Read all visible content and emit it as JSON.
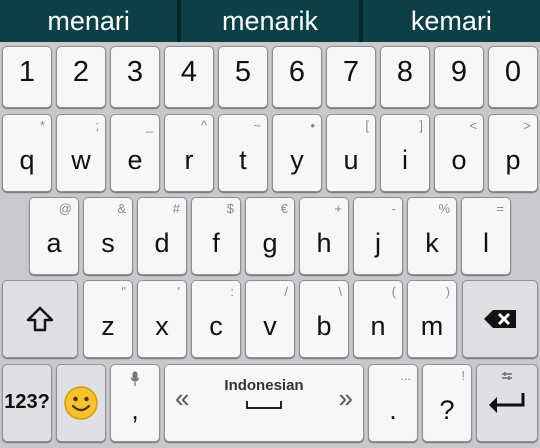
{
  "suggestions": [
    "menari",
    "menarik",
    "kemari"
  ],
  "rows": {
    "numbers": [
      "1",
      "2",
      "3",
      "4",
      "5",
      "6",
      "7",
      "8",
      "9",
      "0"
    ],
    "qwerty": [
      {
        "label": "q",
        "hint": "*"
      },
      {
        "label": "w",
        "hint": ";"
      },
      {
        "label": "e",
        "hint": "_"
      },
      {
        "label": "r",
        "hint": "^"
      },
      {
        "label": "t",
        "hint": "~"
      },
      {
        "label": "y",
        "hint": "•"
      },
      {
        "label": "u",
        "hint": "["
      },
      {
        "label": "i",
        "hint": "]"
      },
      {
        "label": "o",
        "hint": "<"
      },
      {
        "label": "p",
        "hint": ">"
      }
    ],
    "asdf": [
      {
        "label": "a",
        "hint": "@"
      },
      {
        "label": "s",
        "hint": "&"
      },
      {
        "label": "d",
        "hint": "#"
      },
      {
        "label": "f",
        "hint": "$"
      },
      {
        "label": "g",
        "hint": "€"
      },
      {
        "label": "h",
        "hint": "+"
      },
      {
        "label": "j",
        "hint": "-"
      },
      {
        "label": "k",
        "hint": "%"
      },
      {
        "label": "l",
        "hint": "="
      }
    ],
    "zxcv": [
      {
        "label": "z",
        "hint": "\""
      },
      {
        "label": "x",
        "hint": "'"
      },
      {
        "label": "c",
        "hint": ":"
      },
      {
        "label": "v",
        "hint": "/"
      },
      {
        "label": "b",
        "hint": "\\"
      },
      {
        "label": "n",
        "hint": "("
      },
      {
        "label": "m",
        "hint": ")"
      }
    ]
  },
  "bottom": {
    "symbols_label": "123?",
    "emoji_icon": "smiley-face-icon",
    "comma_label": ",",
    "space_label": "Indonesian",
    "space_left_arrow": "«",
    "space_right_arrow": "»",
    "period_label": ".",
    "period_hint": "...",
    "question_label": "?",
    "question_hint": "!"
  },
  "icons": {
    "shift": "shift-arrow-icon",
    "backspace": "backspace-icon",
    "enter": "enter-arrow-icon",
    "mic": "microphone-icon"
  },
  "colors": {
    "suggestion_bar": "#0d3f47",
    "keyboard_bg": "#c7c9cd",
    "key_bg": "#f7f7f8",
    "func_key_bg": "#dfe0e3"
  }
}
